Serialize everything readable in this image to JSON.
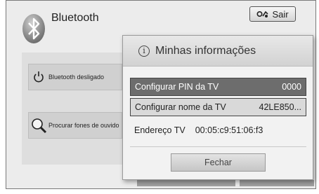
{
  "header": {
    "title": "Bluetooth",
    "exit_label": "Sair"
  },
  "sidebar": {
    "items": [
      {
        "label": "Bluetooth desligado",
        "icon": "power-icon"
      },
      {
        "label": "Procurar fones de ouvido",
        "icon": "magnifier-icon"
      }
    ]
  },
  "dialog": {
    "title": "Minhas informações",
    "rows": [
      {
        "label": "Configurar PIN da TV",
        "value": "0000",
        "selected": true
      },
      {
        "label": "Configurar nome da TV",
        "value": "42LE850...",
        "selected": false
      }
    ],
    "address_label": "Endereço TV",
    "address_value": "00:05:c9:51:06:f3",
    "close_label": "Fechar"
  },
  "colors": {
    "selected_row": "#6d6d6d",
    "background": "#ececec"
  }
}
